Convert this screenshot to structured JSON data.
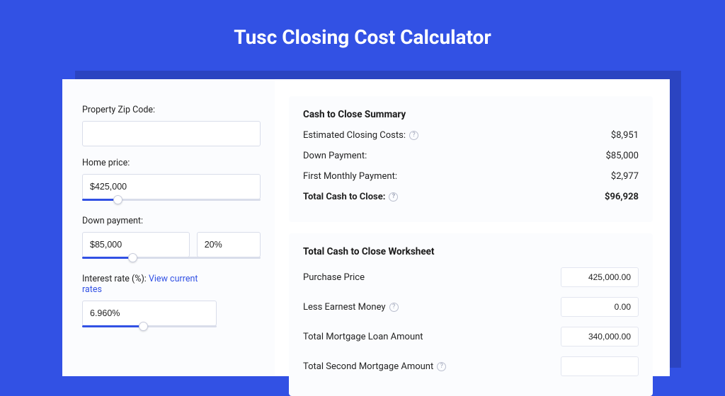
{
  "title": "Tusc Closing Cost Calculator",
  "left": {
    "zip_label": "Property Zip Code:",
    "zip_value": "",
    "home_price_label": "Home price:",
    "home_price_value": "$425,000",
    "home_price_slider": {
      "fill_pct": 20,
      "thumb_pct": 20
    },
    "down_payment_label": "Down payment:",
    "down_payment_value": "$85,000",
    "down_payment_pct": "20%",
    "down_payment_slider": {
      "fill_pct": 28,
      "thumb_pct": 28
    },
    "interest_label_prefix": "Interest rate (%): ",
    "interest_link": "View current rates",
    "interest_value": "6.960%",
    "interest_slider": {
      "fill_pct": 45,
      "thumb_pct": 45
    }
  },
  "summary": {
    "title": "Cash to Close Summary",
    "rows": [
      {
        "label": "Estimated Closing Costs:",
        "help": true,
        "value": "$8,951",
        "bold": false
      },
      {
        "label": "Down Payment:",
        "help": false,
        "value": "$85,000",
        "bold": false
      },
      {
        "label": "First Monthly Payment:",
        "help": false,
        "value": "$2,977",
        "bold": false
      },
      {
        "label": "Total Cash to Close:",
        "help": true,
        "value": "$96,928",
        "bold": true
      }
    ]
  },
  "worksheet": {
    "title": "Total Cash to Close Worksheet",
    "rows": [
      {
        "label": "Purchase Price",
        "help": false,
        "value": "425,000.00"
      },
      {
        "label": "Less Earnest Money",
        "help": true,
        "value": "0.00"
      },
      {
        "label": "Total Mortgage Loan Amount",
        "help": false,
        "value": "340,000.00"
      },
      {
        "label": "Total Second Mortgage Amount",
        "help": true,
        "value": ""
      }
    ]
  }
}
